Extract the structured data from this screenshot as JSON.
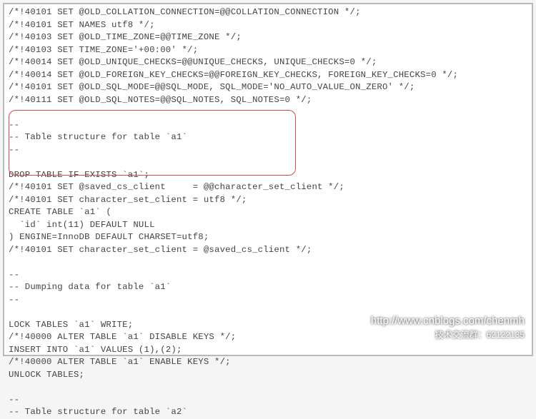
{
  "lines": [
    "/*!40101 SET @OLD_COLLATION_CONNECTION=@@COLLATION_CONNECTION */;",
    "/*!40101 SET NAMES utf8 */;",
    "/*!40103 SET @OLD_TIME_ZONE=@@TIME_ZONE */;",
    "/*!40103 SET TIME_ZONE='+00:00' */;",
    "/*!40014 SET @OLD_UNIQUE_CHECKS=@@UNIQUE_CHECKS, UNIQUE_CHECKS=0 */;",
    "/*!40014 SET @OLD_FOREIGN_KEY_CHECKS=@@FOREIGN_KEY_CHECKS, FOREIGN_KEY_CHECKS=0 */;",
    "/*!40101 SET @OLD_SQL_MODE=@@SQL_MODE, SQL_MODE='NO_AUTO_VALUE_ON_ZERO' */;",
    "/*!40111 SET @OLD_SQL_NOTES=@@SQL_NOTES, SQL_NOTES=0 */;",
    "",
    "--",
    "-- Table structure for table `a1`",
    "--",
    "",
    "DROP TABLE IF EXISTS `a1`;",
    "/*!40101 SET @saved_cs_client     = @@character_set_client */;",
    "/*!40101 SET character_set_client = utf8 */;",
    "CREATE TABLE `a1` (",
    "  `id` int(11) DEFAULT NULL",
    ") ENGINE=InnoDB DEFAULT CHARSET=utf8;",
    "/*!40101 SET character_set_client = @saved_cs_client */;",
    "",
    "--",
    "-- Dumping data for table `a1`",
    "--",
    "",
    "LOCK TABLES `a1` WRITE;",
    "/*!40000 ALTER TABLE `a1` DISABLE KEYS */;",
    "INSERT INTO `a1` VALUES (1),(2);",
    "/*!40000 ALTER TABLE `a1` ENABLE KEYS */;",
    "UNLOCK TABLES;",
    "",
    "--",
    "-- Table structure for table `a2`"
  ],
  "watermark": {
    "url": "http://www.cnblogs.com/chenmh",
    "group": "技术交流群：62122135"
  }
}
